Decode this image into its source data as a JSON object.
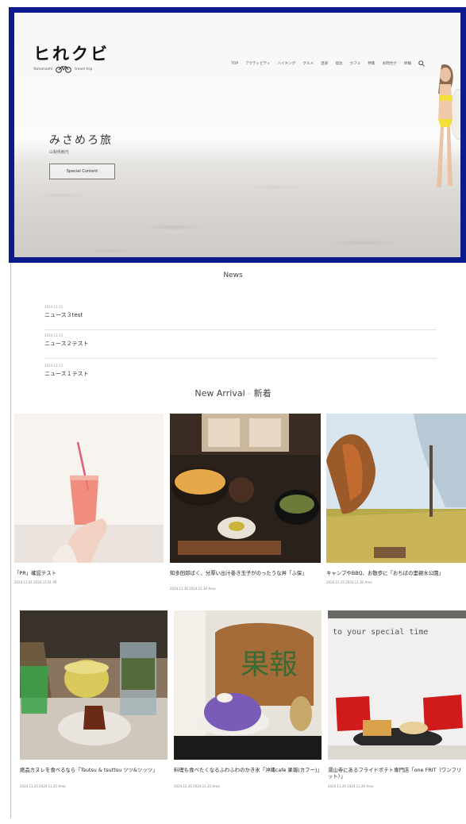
{
  "header": {
    "logo_text": "ヒれクビ",
    "logo_sub_left": "Yamanashi",
    "logo_sub_right": "travel trip",
    "nav": [
      "TOP",
      "アクティビティ",
      "ハイキング",
      "グルメ",
      "温泉",
      "宿泊",
      "カフェ",
      "特集",
      "お問合せ",
      "体験"
    ]
  },
  "hero": {
    "title": "みさめろ旅",
    "subtitle": "山梨県観光",
    "button_label": "Special Content"
  },
  "news": {
    "title": "News",
    "items": [
      {
        "date": "2024.11.13",
        "label": "ニュース３test"
      },
      {
        "date": "2024.11.13",
        "label": "ニュース２テスト"
      },
      {
        "date": "2024.11.13",
        "label": "ニュース１テスト"
      }
    ]
  },
  "arrival": {
    "title_en": "New Arrival",
    "title_ja": "新着"
  },
  "cards": [
    {
      "title": "「PR」確認テスト",
      "meta": "2024.12.01 2024.12.01 PR"
    },
    {
      "title": "知多田郎ばく、分厚い出汁巻き玉子がのったうな丼「ふ保」",
      "meta": "2024.11.30 2024.11.30 Area"
    },
    {
      "title": "キャンプやBBQ、お散歩に「おちばの里親水公園」",
      "meta": "2024.11.25 2024.11.30 Area"
    },
    {
      "title": "絶品カヌレを食べるなら「Tsutsu & tsuttsu ツツ&ツッツ」",
      "meta": "2024.11.25 2024.11.25 Area"
    },
    {
      "title": "料理も食べたくなるふわふわのかき氷「沖縄cafe 果報(カフー)」",
      "meta": "2024.11.20 2024.11.20 Area"
    },
    {
      "title": "湯山寺にあるフライドポテト専門店「one FRIT（ワンフリット）」",
      "meta": "2024.11.20 2024.11.20 Area"
    }
  ],
  "colors": {
    "hero_border": "#0d1a8c",
    "divider": "#e4e4e4"
  }
}
